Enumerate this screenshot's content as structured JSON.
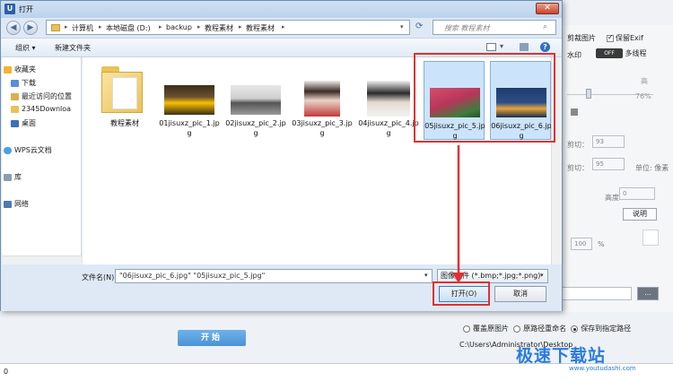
{
  "dialog": {
    "title": "打开",
    "app_icon_text": "U",
    "close_symbol": "✕",
    "breadcrumb": [
      "计算机",
      "本地磁盘 (D:)",
      "backup",
      "教程素材",
      "教程素材"
    ],
    "search_placeholder": "搜索 教程素材",
    "toolbar": {
      "organize": "组织 ▾",
      "new_folder": "新建文件夹"
    },
    "nav_pane": [
      {
        "label": "收藏夹",
        "icon": "star-icon",
        "color": "#f2b431"
      },
      {
        "label": "下载",
        "icon": "download-folder-icon",
        "color": "#5c8fd6"
      },
      {
        "label": "最近访问的位置",
        "icon": "recent-icon",
        "color": "#d9b14a"
      },
      {
        "label": "2345Downloa",
        "icon": "folder-icon",
        "color": "#e6c25a"
      },
      {
        "label": "桌面",
        "icon": "desktop-icon",
        "color": "#3d6fb8"
      },
      {
        "label": "WPS云文档",
        "icon": "cloud-icon",
        "color": "#4aa0e6"
      },
      {
        "label": "库",
        "icon": "library-icon",
        "color": "#8b9cb4"
      },
      {
        "label": "网络",
        "icon": "network-icon",
        "color": "#4f78b5"
      }
    ],
    "files": [
      {
        "name": "教程素材",
        "kind": "folder"
      },
      {
        "name": "01jisuxz_pic_1.jpg",
        "kind": "image",
        "colors": [
          "#f7c000",
          "#3b2e1a"
        ]
      },
      {
        "name": "02jisuxz_pic_2.jpg",
        "kind": "image",
        "colors": [
          "#e7e7e7",
          "#555555"
        ]
      },
      {
        "name": "03jisuxz_pic_3.jpg",
        "kind": "image",
        "colors": [
          "#f1ece8",
          "#c23a3a"
        ]
      },
      {
        "name": "04jisuxz_pic_4.jpg",
        "kind": "image",
        "colors": [
          "#f2f2f2",
          "#2a2a2a"
        ]
      },
      {
        "name": "05jisuxz_pic_5.jpg",
        "kind": "image",
        "selected": true,
        "colors": [
          "#d44f6e",
          "#3d7d3a"
        ]
      },
      {
        "name": "06jisuxz_pic_6.jpg",
        "kind": "image",
        "selected": true,
        "colors": [
          "#1f3a6e",
          "#e9a53c"
        ]
      }
    ],
    "filename_label": "文件名(N):",
    "filename_value": "\"06jisuxz_pic_6.jpg\" \"05jisuxz_pic_5.jpg\"",
    "filetype_value": "图像文件 (*.bmp;*.jpg;*.png)",
    "open_label": "打开(O)",
    "cancel_label": "取消"
  },
  "background_app": {
    "crop_image": "剪裁图片",
    "keep_exif": "保留Exif",
    "watermark": "水印",
    "toggle": "OFF",
    "multiline": "多线程",
    "high": "高",
    "quality_pct": "76%",
    "crop_h": "剪切：",
    "crop_h_value": "93",
    "crop_v": "剪切：",
    "crop_v_value": "95",
    "unit": "单位: 像素",
    "height": "高度：",
    "height_value": "0",
    "explain": "说明",
    "scale_value": "100",
    "pct": "%",
    "browse": "...",
    "overwrite": "覆盖原图片",
    "rename": "原路径重命名",
    "save_path": "保存到指定路径",
    "path_value": "C:\\Users\\Administrator\\Desktop",
    "start": "开始",
    "status": "0"
  },
  "watermark": {
    "brand": "极速下载站",
    "url": "www.youtudashi.com",
    "color": "#2a7be0"
  },
  "highlight_color": "#e03131"
}
